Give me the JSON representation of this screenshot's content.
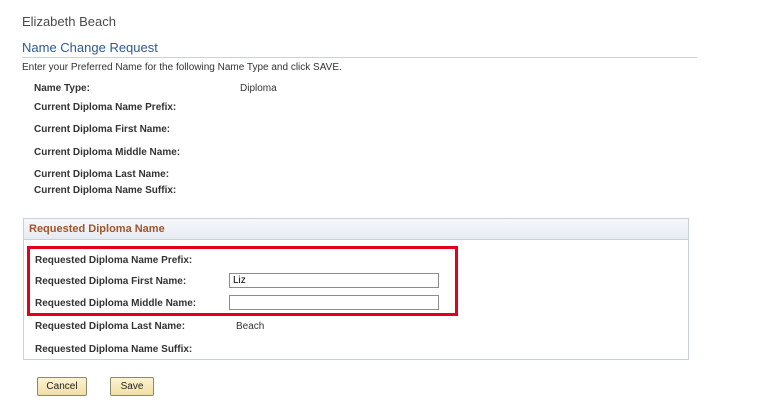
{
  "header": {
    "person_name": "Elizabeth Beach",
    "page_title": "Name Change Request",
    "instructions": "Enter your Preferred Name for the following Name Type and click SAVE."
  },
  "current": {
    "name_type_label": "Name Type:",
    "name_type_value": "Diploma",
    "prefix_label": "Current Diploma Name Prefix:",
    "first_label": "Current Diploma First Name:",
    "middle_label": "Current Diploma Middle Name:",
    "last_label": "Current Diploma Last Name:",
    "suffix_label": "Current Diploma Name Suffix:"
  },
  "requested": {
    "group_title": "Requested Diploma Name",
    "prefix_label": "Requested Diploma Name Prefix:",
    "first_label": "Requested Diploma First Name:",
    "first_value": "Liz",
    "middle_label": "Requested Diploma Middle Name:",
    "middle_value": "",
    "last_label": "Requested Diploma Last Name:",
    "last_value": "Beach",
    "suffix_label": "Requested Diploma Name Suffix:"
  },
  "buttons": {
    "cancel": "Cancel",
    "save": "Save"
  },
  "colors": {
    "highlight": "#e3001b",
    "group_title": "#a0562a",
    "page_title": "#2a5a96"
  }
}
